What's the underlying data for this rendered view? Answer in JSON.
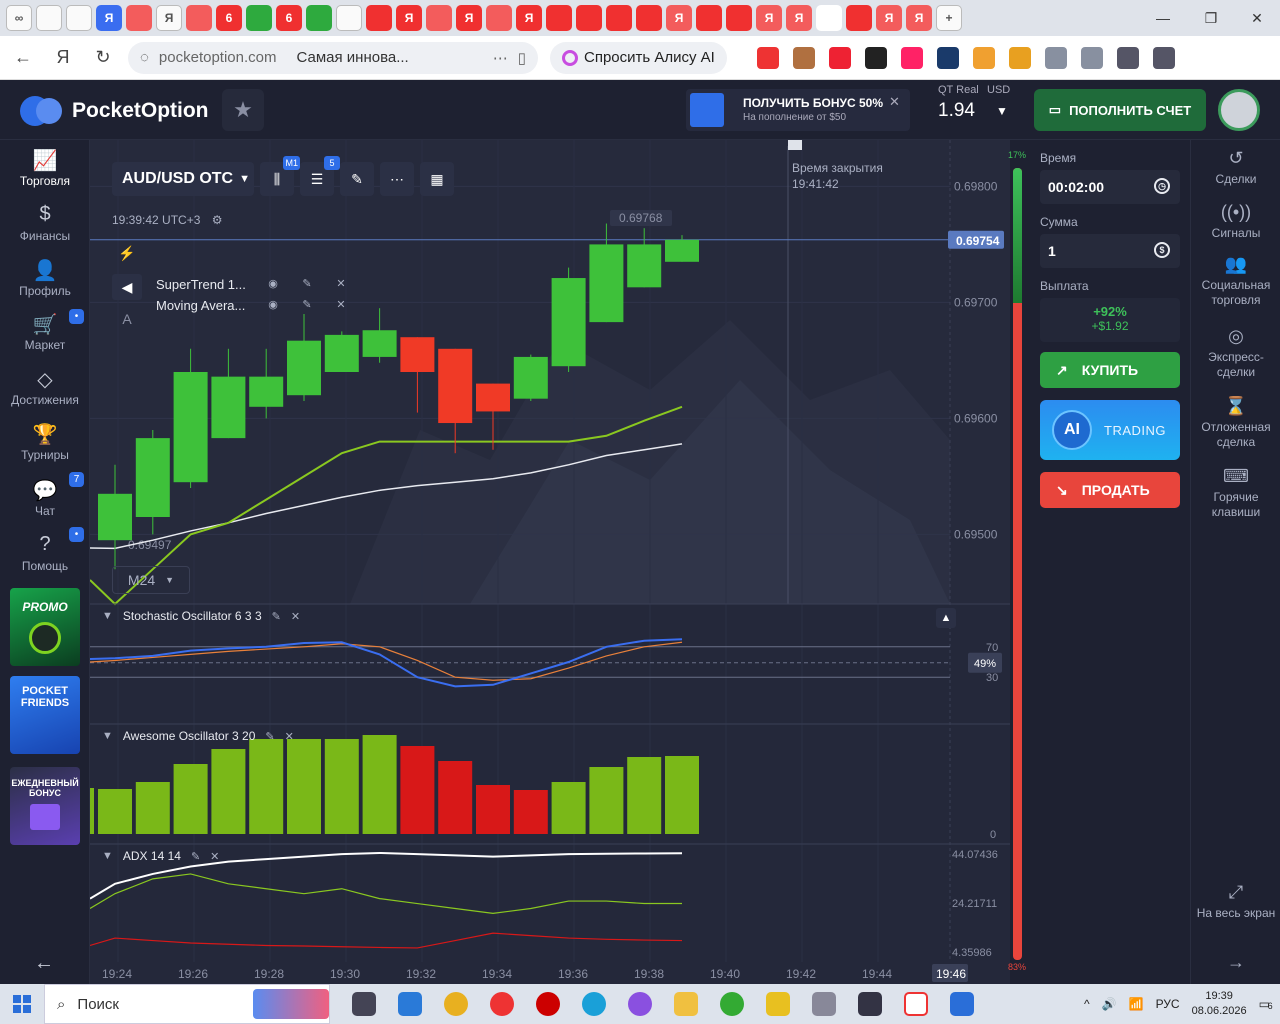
{
  "browser": {
    "url_host": "pocketoption.com",
    "page_title": "Самая иннова...",
    "alice_label": "Спросить Алису AI",
    "tab_letters": [
      "∞",
      "",
      "",
      "Я",
      "",
      "Я",
      "",
      "6",
      "",
      "6",
      "",
      "",
      "",
      "Я",
      "",
      "Я",
      "",
      "Я",
      "",
      "",
      "",
      "",
      "Я",
      "",
      "",
      "Я",
      "Я",
      "",
      "",
      "Я",
      "Я"
    ]
  },
  "header": {
    "logo_text": "PocketOption",
    "promo_title": "ПОЛУЧИТЬ БОНУС 50%",
    "promo_sub": "На пополнение от $50",
    "account_type": "QT Real",
    "account_currency": "USD",
    "balance": "1.94",
    "deposit_label": "ПОПОЛНИТЬ СЧЕТ"
  },
  "left_nav": [
    {
      "label": "Торговля",
      "icon": "chart-icon"
    },
    {
      "label": "Финансы",
      "icon": "dollar-icon"
    },
    {
      "label": "Профиль",
      "icon": "user-icon"
    },
    {
      "label": "Маркет",
      "icon": "cart-icon",
      "badge": "🔔"
    },
    {
      "label": "Достижения",
      "icon": "diamond-icon"
    },
    {
      "label": "Турниры",
      "icon": "trophy-icon"
    },
    {
      "label": "Чат",
      "icon": "chat-icon",
      "badge": "7"
    },
    {
      "label": "Помощь",
      "icon": "help-icon",
      "badge": "🔔"
    }
  ],
  "side_cards": {
    "promo": "PROMO",
    "friends_line1": "POCKET",
    "friends_line2": "FRIENDS",
    "daily_line1": "ЕЖЕДНЕВНЫЙ",
    "daily_line2": "БОНУС"
  },
  "chart": {
    "pair": "AUD/USD OTC",
    "candle_badge": "M1",
    "indicators_badge": "5",
    "clock": "19:39:42 UTC+3",
    "timeframe": "M24",
    "close_time_label": "Время закрытия",
    "close_time_value": "19:41:42",
    "current_price": "0.69754",
    "high_label": "0.69768",
    "low_label": "0.69497",
    "indicators": [
      "SuperTrend 1...",
      "Moving Avera..."
    ],
    "price_ticks": [
      "0.69800",
      "0.69700",
      "0.69600",
      "0.69500"
    ],
    "stoch_title": "Stochastic Oscillator  6 3 3",
    "stoch_levels": [
      "70",
      "30"
    ],
    "stoch_current": "49%",
    "ao_title": "Awesome Oscillator  3 20",
    "ao_zero": "0",
    "adx_title": "ADX  14 14",
    "adx_ticks": [
      "44.07436",
      "24.21711",
      "4.35986"
    ],
    "time_ticks": [
      "19:24",
      "19:26",
      "19:28",
      "19:30",
      "19:32",
      "19:34",
      "19:36",
      "19:38",
      "19:40",
      "19:42",
      "19:44"
    ],
    "time_current": "19:46",
    "progress_top": "17%",
    "progress_bottom": "83%"
  },
  "chart_data": {
    "type": "candlestick",
    "candles": [
      {
        "o": 0.69495,
        "h": 0.6956,
        "l": 0.6947,
        "c": 0.69535,
        "dir": "up"
      },
      {
        "o": 0.69515,
        "h": 0.6959,
        "l": 0.695,
        "c": 0.69583,
        "dir": "up"
      },
      {
        "o": 0.69545,
        "h": 0.6966,
        "l": 0.6954,
        "c": 0.6964,
        "dir": "up"
      },
      {
        "o": 0.69583,
        "h": 0.6966,
        "l": 0.69583,
        "c": 0.69636,
        "dir": "up"
      },
      {
        "o": 0.6961,
        "h": 0.6966,
        "l": 0.696,
        "c": 0.69636,
        "dir": "up"
      },
      {
        "o": 0.6962,
        "h": 0.6969,
        "l": 0.69615,
        "c": 0.69667,
        "dir": "up"
      },
      {
        "o": 0.6964,
        "h": 0.69675,
        "l": 0.6964,
        "c": 0.69672,
        "dir": "up"
      },
      {
        "o": 0.69653,
        "h": 0.69695,
        "l": 0.69648,
        "c": 0.69676,
        "dir": "up"
      },
      {
        "o": 0.6967,
        "h": 0.6967,
        "l": 0.69605,
        "c": 0.6964,
        "dir": "down"
      },
      {
        "o": 0.6966,
        "h": 0.6966,
        "l": 0.6957,
        "c": 0.69596,
        "dir": "down"
      },
      {
        "o": 0.6963,
        "h": 0.6963,
        "l": 0.69573,
        "c": 0.69606,
        "dir": "down"
      },
      {
        "o": 0.69617,
        "h": 0.69655,
        "l": 0.69615,
        "c": 0.69653,
        "dir": "up"
      },
      {
        "o": 0.69645,
        "h": 0.6973,
        "l": 0.6964,
        "c": 0.69721,
        "dir": "up"
      },
      {
        "o": 0.69683,
        "h": 0.69768,
        "l": 0.69683,
        "c": 0.6975,
        "dir": "up"
      },
      {
        "o": 0.69713,
        "h": 0.69764,
        "l": 0.69713,
        "c": 0.6975,
        "dir": "up"
      },
      {
        "o": 0.69735,
        "h": 0.69758,
        "l": 0.69735,
        "c": 0.69754,
        "dir": "up"
      }
    ],
    "supertrend": [
      0.6944,
      0.6947,
      0.695,
      0.6951,
      0.6953,
      0.6955,
      0.6957,
      0.6958,
      0.6958,
      0.6958,
      0.6958,
      0.6958,
      0.6958,
      0.69585,
      0.69598,
      0.6961
    ],
    "moving_average": [
      0.69488,
      0.69495,
      0.69503,
      0.6951,
      0.69518,
      0.69525,
      0.69532,
      0.69538,
      0.69542,
      0.69545,
      0.69548,
      0.69553,
      0.6956,
      0.69568,
      0.69573,
      0.69578
    ],
    "stoch_k": [
      55,
      58,
      65,
      68,
      70,
      75,
      76,
      60,
      30,
      18,
      20,
      35,
      50,
      70,
      78,
      80
    ],
    "stoch_d": [
      52,
      56,
      60,
      64,
      67,
      70,
      74,
      70,
      52,
      30,
      26,
      28,
      42,
      58,
      70,
      76
    ],
    "awesome": [
      45,
      52,
      70,
      85,
      95,
      95,
      95,
      99,
      88,
      73,
      49,
      44,
      52,
      67,
      77,
      78
    ],
    "awesome_dir": [
      "up",
      "up",
      "up",
      "up",
      "up",
      "up",
      "up",
      "up",
      "down",
      "down",
      "down",
      "down",
      "up",
      "up",
      "up",
      "up"
    ],
    "adx": [
      32,
      36,
      39,
      41,
      42,
      43,
      44,
      44.5,
      44,
      43.5,
      43,
      43.5,
      44,
      44.2,
      44.3,
      44.4
    ],
    "plus_di": [
      28,
      34,
      36,
      32,
      30,
      28,
      30,
      26,
      24,
      22,
      20,
      22,
      25,
      25,
      24,
      24
    ],
    "minus_di": [
      10,
      9,
      8,
      7.5,
      7,
      6.8,
      6.5,
      6.2,
      6,
      9,
      12,
      11,
      10,
      9.5,
      9.2,
      9
    ],
    "ylim": [
      0.6944,
      0.6984
    ],
    "xlabel": "",
    "ylabel": ""
  },
  "trade": {
    "time_label": "Время",
    "time_value": "00:02:00",
    "amount_label": "Сумма",
    "amount_value": "1",
    "payout_label": "Выплата",
    "payout_pct": "+92%",
    "payout_amount": "+$1.92",
    "buy_label": "КУПИТЬ",
    "ai_label": "TRADING",
    "ai_circle": "AI",
    "sell_label": "ПРОДАТЬ"
  },
  "right_nav": [
    {
      "label": "Сделки",
      "icon": "history-icon"
    },
    {
      "label": "Сигналы",
      "icon": "signal-icon"
    },
    {
      "label": "Социальная торговля",
      "icon": "social-icon"
    },
    {
      "label": "Экспресс-сделки",
      "icon": "express-icon"
    },
    {
      "label": "Отложенная сделка",
      "icon": "hourglass-icon"
    },
    {
      "label": "Горячие клавиши",
      "icon": "keyboard-icon"
    },
    {
      "label": "На весь экран",
      "icon": "fullscreen-icon"
    }
  ],
  "taskbar": {
    "search_label": "Поиск",
    "lang": "РУС",
    "time": "19:39",
    "date": "08.06.2026",
    "notif": "6"
  },
  "colors": {
    "up": "#3ec13a",
    "down": "#f03a26",
    "accent": "#2f6ee8"
  }
}
